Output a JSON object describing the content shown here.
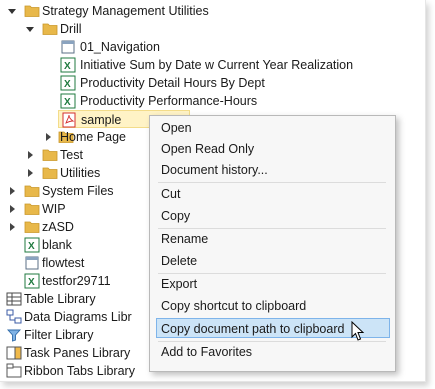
{
  "tree": {
    "items": [
      {
        "label": "Strategy Management Utilities",
        "icon": "folder-icon",
        "expander": "down"
      },
      {
        "label": "Drill",
        "icon": "folder-icon",
        "expander": "down"
      },
      {
        "label": "01_Navigation",
        "icon": "page-icon",
        "expander": "none"
      },
      {
        "label": "Initiative Sum by Date w Current Year Realization",
        "icon": "excel-icon",
        "expander": "none"
      },
      {
        "label": "Productivity Detail Hours By Dept",
        "icon": "excel-icon",
        "expander": "none"
      },
      {
        "label": "Productivity Performance-Hours",
        "icon": "excel-icon",
        "expander": "none"
      },
      {
        "label": "sample",
        "icon": "pdf-icon",
        "expander": "none",
        "selected": true
      },
      {
        "label": "Home Page",
        "icon": "folder-icon",
        "expander": "right"
      },
      {
        "label": "Test",
        "icon": "folder-icon",
        "expander": "right"
      },
      {
        "label": "Utilities",
        "icon": "folder-icon",
        "expander": "right"
      },
      {
        "label": "System Files",
        "icon": "folder-icon",
        "expander": "right"
      },
      {
        "label": "WIP",
        "icon": "folder-icon",
        "expander": "right"
      },
      {
        "label": "zASD",
        "icon": "folder-icon",
        "expander": "right"
      },
      {
        "label": "blank",
        "icon": "excel-icon",
        "expander": "none"
      },
      {
        "label": "flowtest",
        "icon": "page-icon",
        "expander": "none"
      },
      {
        "label": "testfor29711",
        "icon": "excel-icon",
        "expander": "none"
      },
      {
        "label": "Table Library",
        "icon": "table-library-icon",
        "expander": "none"
      },
      {
        "label": "Data Diagrams Libr",
        "icon": "data-diagrams-icon",
        "expander": "none"
      },
      {
        "label": "Filter Library",
        "icon": "filter-icon",
        "expander": "none"
      },
      {
        "label": "Task Panes Library",
        "icon": "task-panes-icon",
        "expander": "none"
      },
      {
        "label": "Ribbon Tabs Library",
        "icon": "ribbon-tabs-icon",
        "expander": "none"
      }
    ]
  },
  "context_menu": {
    "items": [
      {
        "label": "Open"
      },
      {
        "label": "Open Read Only"
      },
      {
        "label": "Document history..."
      },
      {
        "label": "Cut"
      },
      {
        "label": "Copy"
      },
      {
        "label": "Rename"
      },
      {
        "label": "Delete"
      },
      {
        "label": "Export"
      },
      {
        "label": "Copy shortcut to clipboard"
      },
      {
        "label": "Copy document path to clipboard",
        "highlighted": true
      },
      {
        "label": "Add to Favorites"
      }
    ]
  },
  "colors": {
    "folder": "#e8b84a",
    "excel": "#1f7a3f",
    "pdf": "#d32f2f",
    "selection": "#fff3c6",
    "menu_highlight": "#cce4f7"
  }
}
